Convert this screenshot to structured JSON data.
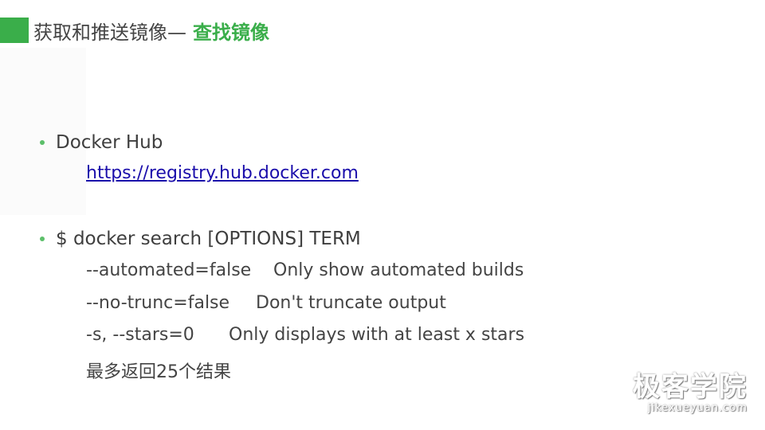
{
  "header": {
    "title": "获取和推送镜像—",
    "highlight": "查找镜像",
    "accent_color": "#3aae4a"
  },
  "bullets": [
    {
      "label": "Docker Hub",
      "link": "https://registry.hub.docker.com"
    },
    {
      "label": "$ docker search [OPTIONS] TERM",
      "options": [
        {
          "flag": "--automated=false",
          "desc": "Only show automated builds"
        },
        {
          "flag": "--no-trunc=false",
          "desc": "Don't truncate output"
        },
        {
          "flag": "-s, --stars=0",
          "desc": "Only displays with at least x stars"
        }
      ],
      "note": "最多返回25个结果"
    }
  ],
  "watermark": {
    "brand": "极客学院",
    "url": "jikexueyuan.com"
  },
  "colors": {
    "bullet_dot": "#5cbf6a",
    "link": "#1a0dab"
  }
}
